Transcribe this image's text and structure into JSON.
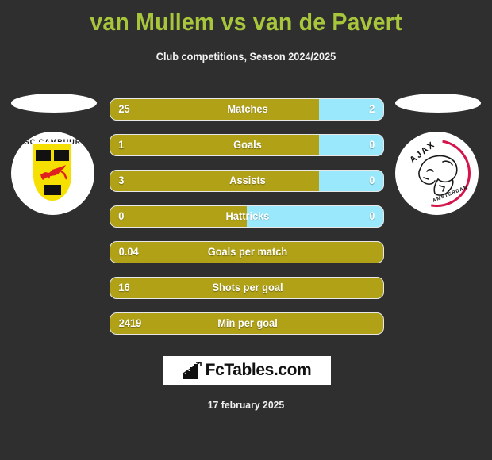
{
  "header": {
    "title": "van Mullem vs van de Pavert",
    "subtitle": "Club competitions, Season 2024/2025",
    "title_color": "#a8c63c"
  },
  "teams": {
    "left": {
      "logo_name": "sc-cambuur-logo",
      "crest_text": "SC CAMBUUR"
    },
    "right": {
      "logo_name": "ajax-logo",
      "crest_text": "AJAX",
      "crest_subtext": "AMSTERDAM"
    }
  },
  "colors": {
    "player1_bar": "#b0a117",
    "player2_bar": "#9ae8fb",
    "background": "#2f2f2f"
  },
  "footer": {
    "logo_text": "FcTables.com",
    "logo_icon": "bar-chart-icon",
    "date": "17 february 2025"
  },
  "chart_data": {
    "type": "bar",
    "title": "van Mullem vs van de Pavert",
    "subtitle": "Club competitions, Season 2024/2025",
    "orientation": "horizontal-diverging",
    "series": [
      {
        "name": "van Mullem",
        "color": "#b0a117",
        "values": [
          25,
          1,
          3,
          0,
          0.04,
          16,
          2419
        ]
      },
      {
        "name": "van de Pavert",
        "color": "#9ae8fb",
        "values": [
          2,
          0,
          0,
          0,
          null,
          null,
          null
        ]
      }
    ],
    "categories": [
      "Matches",
      "Goals",
      "Assists",
      "Hattricks",
      "Goals per match",
      "Shots per goal",
      "Min per goal"
    ],
    "rows": [
      {
        "label": "Matches",
        "left": "25",
        "right": "2",
        "left_pct": 76.5,
        "has_right": true
      },
      {
        "label": "Goals",
        "left": "1",
        "right": "0",
        "left_pct": 76.5,
        "has_right": true
      },
      {
        "label": "Assists",
        "left": "3",
        "right": "0",
        "left_pct": 76.5,
        "has_right": true
      },
      {
        "label": "Hattricks",
        "left": "0",
        "right": "0",
        "left_pct": 50.0,
        "has_right": true
      },
      {
        "label": "Goals per match",
        "left": "0.04",
        "right": "",
        "left_pct": 100,
        "has_right": false
      },
      {
        "label": "Shots per goal",
        "left": "16",
        "right": "",
        "left_pct": 100,
        "has_right": false
      },
      {
        "label": "Min per goal",
        "left": "2419",
        "right": "",
        "left_pct": 100,
        "has_right": false
      }
    ],
    "grid": false,
    "legend": "none"
  }
}
